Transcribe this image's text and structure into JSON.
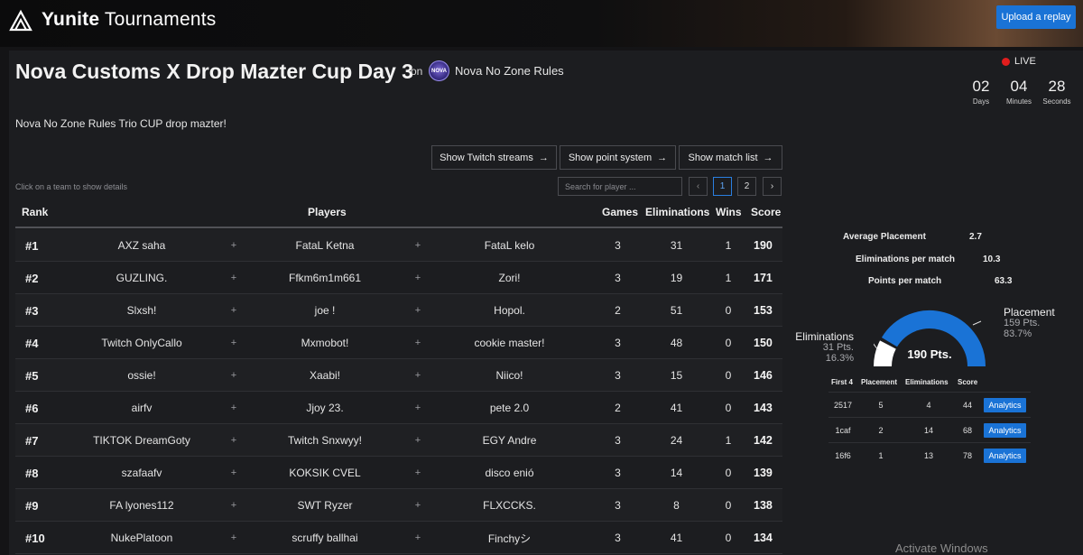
{
  "header": {
    "brand": "Yunite Tournaments",
    "brand_bold": "Yunite",
    "brand_light": " Tournaments",
    "upload_label": "Upload a replay"
  },
  "event": {
    "title": "Nova Customs X Drop Mazter Cup Day 3",
    "on": "on",
    "org_name": "Nova No Zone Rules",
    "org_badge_text": "NOVA",
    "description": "Nova No Zone Rules Trio CUP drop mazter!",
    "live_label": "LIVE",
    "countdown": [
      {
        "value": "02",
        "label": "Days"
      },
      {
        "value": "04",
        "label": "Minutes"
      },
      {
        "value": "28",
        "label": "Seconds"
      }
    ]
  },
  "actions": {
    "twitch": "Show Twitch streams",
    "points": "Show point system",
    "matches": "Show match list"
  },
  "table_controls": {
    "hint": "Click on a team to show details",
    "search_placeholder": "Search for player ...",
    "prev": "‹",
    "next": "›",
    "pages": [
      "1",
      "2"
    ],
    "active_page": "1"
  },
  "leaderboard": {
    "columns": {
      "rank": "Rank",
      "players": "Players",
      "games": "Games",
      "elims": "Eliminations",
      "wins": "Wins",
      "score": "Score"
    },
    "rows": [
      {
        "rank": "#1",
        "p1": "AXZ saha",
        "p2": "FataL Ketna",
        "p3": "FataL kelo",
        "games": "3",
        "elims": "31",
        "wins": "1",
        "score": "190"
      },
      {
        "rank": "#2",
        "p1": "GUZLING.",
        "p2": "Ffkm6m1m661",
        "p3": "Zori!",
        "games": "3",
        "elims": "19",
        "wins": "1",
        "score": "171"
      },
      {
        "rank": "#3",
        "p1": "Slxsh!",
        "p2": "joe !",
        "p3": "Hopol.",
        "games": "2",
        "elims": "51",
        "wins": "0",
        "score": "153"
      },
      {
        "rank": "#4",
        "p1": "Twitch OnlyCallo",
        "p2": "Mxmobot!",
        "p3": "cookie master!",
        "games": "3",
        "elims": "48",
        "wins": "0",
        "score": "150"
      },
      {
        "rank": "#5",
        "p1": "ossie!",
        "p2": "Xaabi!",
        "p3": "Niico!",
        "games": "3",
        "elims": "15",
        "wins": "0",
        "score": "146"
      },
      {
        "rank": "#6",
        "p1": "airfv",
        "p2": "Jjoy 23.",
        "p3": "pete 2.0",
        "games": "2",
        "elims": "41",
        "wins": "0",
        "score": "143"
      },
      {
        "rank": "#7",
        "p1": "TIKTOK DreamGoty",
        "p2": "Twitch Snxwyy!",
        "p3": "EGY Andre",
        "games": "3",
        "elims": "24",
        "wins": "1",
        "score": "142"
      },
      {
        "rank": "#8",
        "p1": "szafaafv",
        "p2": "KOKSIK CVEL",
        "p3": "disco enió",
        "games": "3",
        "elims": "14",
        "wins": "0",
        "score": "139"
      },
      {
        "rank": "#9",
        "p1": "FA lyones112",
        "p2": "SWT Ryzer",
        "p3": "FLXCCKS.",
        "games": "3",
        "elims": "8",
        "wins": "0",
        "score": "138"
      },
      {
        "rank": "#10",
        "p1": "NukePlatoon",
        "p2": "scruffy ballhai",
        "p3": "Finchyシ",
        "games": "3",
        "elims": "41",
        "wins": "0",
        "score": "134"
      }
    ]
  },
  "team_details": {
    "stats": [
      {
        "label": "Average Placement",
        "value": "2.7"
      },
      {
        "label": "Eliminations per match",
        "value": "10.3"
      },
      {
        "label": "Points per match",
        "value": "63.3"
      }
    ],
    "gauge": {
      "total": "190 Pts.",
      "placement_fraction": 0.837,
      "elims_label": "Eliminations",
      "elims_pts": "31 Pts.",
      "elims_pct": "16.3%",
      "placement_label": "Placement",
      "placement_pts": "159 Pts.",
      "placement_pct": "83.7%",
      "color_placement": "#1a73d6",
      "color_elims": "#ffffff"
    },
    "matches_header": {
      "id": "First 4",
      "placement": "Placement",
      "elims": "Eliminations",
      "score": "Score"
    },
    "matches": [
      {
        "id": "2517",
        "placement": "5",
        "elims": "4",
        "score": "44",
        "button": "Analytics"
      },
      {
        "id": "1caf",
        "placement": "2",
        "elims": "14",
        "score": "68",
        "button": "Analytics"
      },
      {
        "id": "16f6",
        "placement": "1",
        "elims": "13",
        "score": "78",
        "button": "Analytics"
      }
    ]
  },
  "os_watermark": "Activate Windows"
}
